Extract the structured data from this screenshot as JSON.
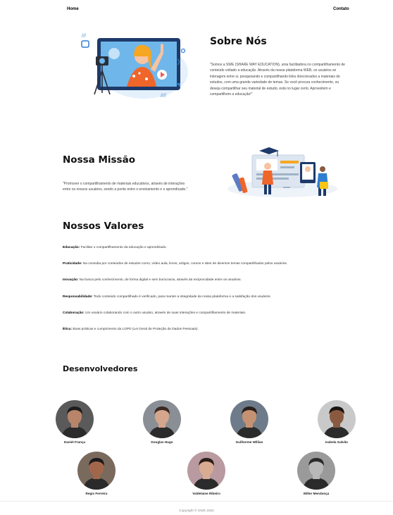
{
  "nav": {
    "home": "Home",
    "contact": "Contato"
  },
  "about": {
    "title": "Sobre Nós",
    "text": "\"Somos a SWE (SHARE WAY EDUCATION), uma facilitadora no compartilhamento de conteúdo voltado a educação. Através da nossa plataforma WEB, os usuários se interagem entre si, pesquisando e compartilhando links direcionados a materiais de estudos, com uma grande variedade de temas. Se você procura conhecimento, ou deseja compartilhar seu material de estudo, está no lugar certo. Aproveitem e compartilhem a educação!\""
  },
  "mission": {
    "title": "Nossa Missão",
    "text": "\"Promover o compartilhamento de materiais educativos, através de interações entre os nossos usuários, sendo a ponte entre o ensinamento e o aprendizado.\""
  },
  "values": {
    "title": "Nossos Valores",
    "items": [
      {
        "label": "Educação:",
        "text": " Facilitar o compartilhamento da educação e aprendizado."
      },
      {
        "label": "Praticidade:",
        "text": " Na consulta por conteúdos de estudos como, vídeo aula, livros, artigos, cursos e sites de diversos temas compartilhados pelos usuários."
      },
      {
        "label": "Inovação:",
        "text": " Na busca pelo conhecimento, de forma digital e sem burocracia, através da reciprocidade entre os usuários."
      },
      {
        "label": "Responsabilidade:",
        "text": " Todo conteúdo compartilhado é verificado, para manter a integridade da nossa plataforma e a satisfação dos usuários."
      },
      {
        "label": "Colaboração:",
        "text": " Um usuário colaborando com o outro usuário, através de suas interações e compartilhamento de materiais."
      },
      {
        "label": "Ética:",
        "text": " Boas práticas e cumprimento da LGPD (Lei Geral de Proteção de Dados Pessoais)."
      }
    ]
  },
  "developers": {
    "title": "Desenvolvedores",
    "people": [
      {
        "name": "Daniel França",
        "skin": "#b9856a",
        "hair": "#1d1d1d",
        "bg": "#5a5a5a"
      },
      {
        "name": "Douglas Hugo",
        "skin": "#d4a68c",
        "hair": "#3b2a22",
        "bg": "#8a8f96"
      },
      {
        "name": "Guilherme Willian",
        "skin": "#c49273",
        "hair": "#2a1f1a",
        "bg": "#6e7b8a"
      },
      {
        "name": "Isabela Galvão",
        "skin": "#8a5a40",
        "hair": "#1a1411",
        "bg": "#c9c9c9"
      },
      {
        "name": "Regis Ferreira",
        "skin": "#a2674a",
        "hair": "#1a1a1a",
        "bg": "#7a6a5e"
      },
      {
        "name": "Valdelaine Ribeiro",
        "skin": "#d9ab93",
        "hair": "#2b1d18",
        "bg": "#b89aa0"
      },
      {
        "name": "Wilter Mendonça",
        "skin": "#b8b8b8",
        "hair": "#2a2a2a",
        "bg": "#9a9a9a"
      }
    ]
  },
  "footer": {
    "copyright": "Copyright © SWE 2022"
  }
}
